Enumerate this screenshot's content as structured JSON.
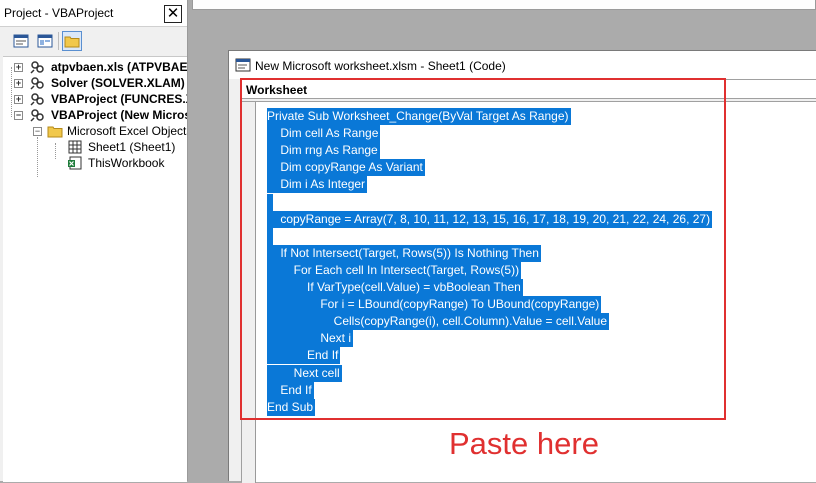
{
  "project_explorer": {
    "title": "Project - VBAProject",
    "close_label": "✕",
    "tree": [
      {
        "label": "atpvbaen.xls (ATPVBAEN.XLAM)",
        "bold": true,
        "expander": "+"
      },
      {
        "label": "Solver (SOLVER.XLAM)",
        "bold": true,
        "expander": "+"
      },
      {
        "label": "VBAProject (FUNCRES.XLAM)",
        "bold": true,
        "expander": "+"
      },
      {
        "label": "VBAProject (New Microsoft worksheet.xlsm)",
        "bold": true,
        "expander": "−"
      },
      {
        "label": "Microsoft Excel Objects",
        "bold": false,
        "expander": "−"
      },
      {
        "label": "Sheet1 (Sheet1)",
        "bold": false
      },
      {
        "label": "ThisWorkbook",
        "bold": false
      }
    ]
  },
  "code_window": {
    "title": "New Microsoft worksheet.xlsm - Sheet1 (Code)",
    "object_combo": "Worksheet",
    "lines": [
      "Private Sub Worksheet_Change(ByVal Target As Range)",
      "    Dim cell As Range",
      "    Dim rng As Range",
      "    Dim copyRange As Variant",
      "    Dim i As Integer",
      "",
      "    copyRange = Array(7, 8, 10, 11, 12, 13, 15, 16, 17, 18, 19, 20, 21, 22, 24, 26, 27)",
      "",
      "    If Not Intersect(Target, Rows(5)) Is Nothing Then",
      "        For Each cell In Intersect(Target, Rows(5))",
      "            If VarType(cell.Value) = vbBoolean Then",
      "                For i = LBound(copyRange) To UBound(copyRange)",
      "                    Cells(copyRange(i), cell.Column).Value = cell.Value",
      "                Next i",
      "            End If",
      "        Next cell",
      "    End If",
      "End Sub"
    ]
  },
  "annotation": {
    "text": "Paste here",
    "color": "#e03030"
  },
  "colors": {
    "selection": "#0a78d7"
  }
}
